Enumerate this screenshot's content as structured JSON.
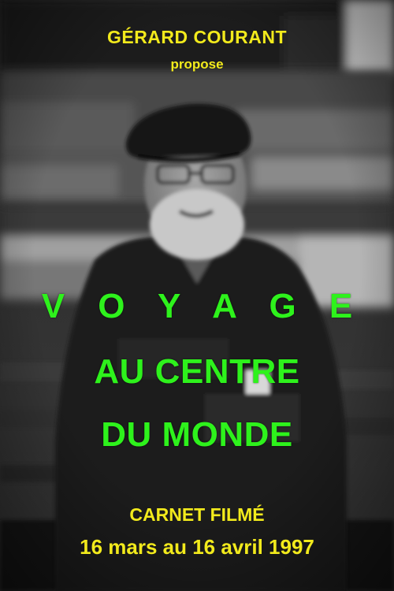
{
  "poster": {
    "credit_name": "GÉRARD COURANT",
    "credit_sub": "propose",
    "title_lines": [
      "V O Y A G E",
      "AU CENTRE",
      "DU MONDE"
    ],
    "info_line_1": "CARNET FILMÉ",
    "info_line_2": "16 mars au 16 avril 1997"
  },
  "colors": {
    "credit": "#f2ea1c",
    "title": "#2ef21c",
    "info": "#f2ea1c"
  }
}
